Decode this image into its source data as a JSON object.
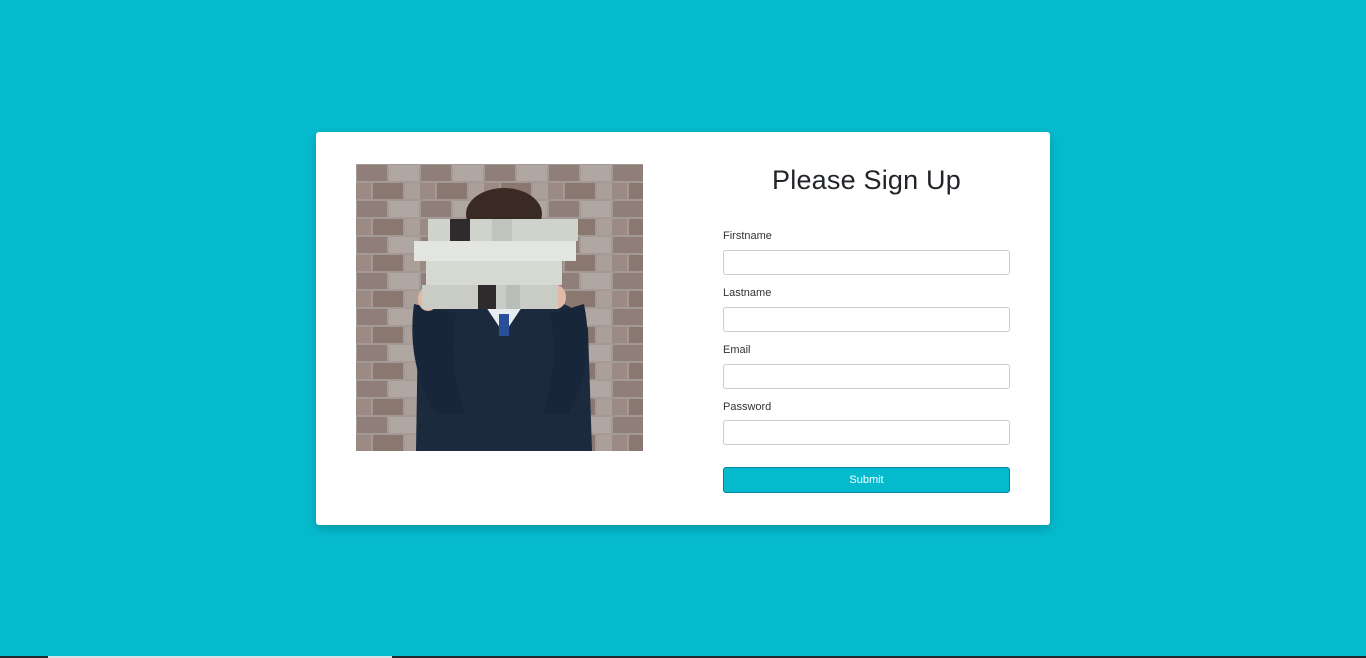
{
  "colors": {
    "background": "#06bacd",
    "card": "#ffffff",
    "button": "#06bacd",
    "button_border": "#0a7fa4",
    "title": "#212529"
  },
  "image": {
    "icon": "person-holding-books-photo"
  },
  "form": {
    "title": "Please Sign Up",
    "fields": [
      {
        "label": "Firstname",
        "value": "",
        "placeholder": ""
      },
      {
        "label": "Lastname",
        "value": "",
        "placeholder": ""
      },
      {
        "label": "Email",
        "value": "",
        "placeholder": ""
      },
      {
        "label": "Password",
        "value": "",
        "placeholder": ""
      }
    ],
    "submit_label": "Submit"
  }
}
